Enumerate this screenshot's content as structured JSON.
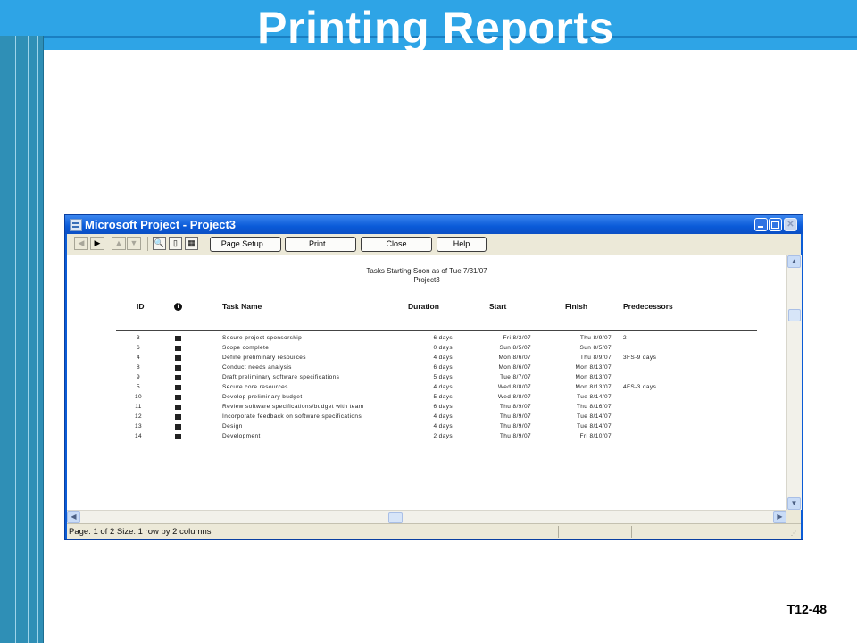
{
  "slide": {
    "title": "Printing Reports",
    "slide_number": "T12-48"
  },
  "window": {
    "title": "Microsoft Project - Project3",
    "controls": {
      "minimize": "_",
      "maximize": "□",
      "close": "✕"
    }
  },
  "toolbar": {
    "nav_icons": [
      "left-arrow-icon",
      "right-arrow-icon",
      "up-arrow-icon",
      "down-arrow-icon"
    ],
    "view_icons": [
      "zoom-icon",
      "one-page-icon",
      "multiple-pages-icon"
    ],
    "page_setup_label": "Page Setup...",
    "print_label": "Print...",
    "close_label": "Close",
    "help_label": "Help"
  },
  "report": {
    "title": "Tasks Starting Soon as of Tue 7/31/07",
    "project": "Project3",
    "columns": {
      "id": "ID",
      "info": "i",
      "task_name": "Task Name",
      "duration": "Duration",
      "start": "Start",
      "finish": "Finish",
      "predecessors": "Predecessors"
    },
    "rows": [
      {
        "id": "3",
        "name": "Secure project sponsorship",
        "duration": "6 days",
        "start": "Fri 8/3/07",
        "finish": "Thu 8/9/07",
        "pred": "2"
      },
      {
        "id": "6",
        "name": "Scope complete",
        "duration": "0 days",
        "start": "Sun 8/5/07",
        "finish": "Sun 8/5/07",
        "pred": ""
      },
      {
        "id": "4",
        "name": "Define preliminary resources",
        "duration": "4 days",
        "start": "Mon 8/6/07",
        "finish": "Thu 8/9/07",
        "pred": "3FS-9 days"
      },
      {
        "id": "8",
        "name": "Conduct needs analysis",
        "duration": "6 days",
        "start": "Mon 8/6/07",
        "finish": "Mon 8/13/07",
        "pred": ""
      },
      {
        "id": "9",
        "name": "Draft preliminary software specifications",
        "duration": "5 days",
        "start": "Tue 8/7/07",
        "finish": "Mon 8/13/07",
        "pred": ""
      },
      {
        "id": "5",
        "name": "Secure core resources",
        "duration": "4 days",
        "start": "Wed 8/8/07",
        "finish": "Mon 8/13/07",
        "pred": "4FS-3 days"
      },
      {
        "id": "10",
        "name": "Develop preliminary budget",
        "duration": "5 days",
        "start": "Wed 8/8/07",
        "finish": "Tue 8/14/07",
        "pred": ""
      },
      {
        "id": "11",
        "name": "Review software specifications/budget with team",
        "duration": "6 days",
        "start": "Thu 8/9/07",
        "finish": "Thu 8/16/07",
        "pred": ""
      },
      {
        "id": "12",
        "name": "Incorporate feedback on software specifications",
        "duration": "4 days",
        "start": "Thu 8/9/07",
        "finish": "Tue 8/14/07",
        "pred": ""
      },
      {
        "id": "13",
        "name": "Design",
        "duration": "4 days",
        "start": "Thu 8/9/07",
        "finish": "Tue 8/14/07",
        "pred": ""
      },
      {
        "id": "14",
        "name": "Development",
        "duration": "2 days",
        "start": "Thu 8/9/07",
        "finish": "Fri 8/10/07",
        "pred": ""
      }
    ]
  },
  "status_bar": {
    "text": "Page: 1 of 2   Size: 1 row by 2 columns"
  },
  "colors": {
    "slide_accent": "#2ea4e6",
    "left_bar": "#2f8fb6",
    "titlebar": "#0b5cd6",
    "toolbar": "#ece9d8"
  }
}
